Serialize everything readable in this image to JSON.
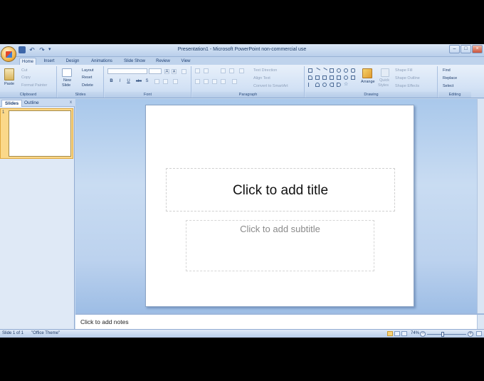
{
  "window": {
    "title": "Presentation1 - Microsoft PowerPoint non-commercial use"
  },
  "quick_access": {
    "more_glyph": "▾"
  },
  "tabs": [
    {
      "label": "Home",
      "active": true
    },
    {
      "label": "Insert"
    },
    {
      "label": "Design"
    },
    {
      "label": "Animations"
    },
    {
      "label": "Slide Show"
    },
    {
      "label": "Review"
    },
    {
      "label": "View"
    }
  ],
  "ribbon": {
    "clipboard": {
      "paste": "Paste",
      "cut": "Cut",
      "copy": "Copy",
      "format_painter": "Format Painter",
      "label": "Clipboard"
    },
    "slides": {
      "new_slide": "New",
      "new_slide2": "Slide",
      "layout": "Layout",
      "reset": "Reset",
      "delete": "Delete",
      "label": "Slides"
    },
    "font": {
      "bold": "B",
      "italic": "I",
      "underline": "U",
      "strike": "abc",
      "shadow": "S",
      "grow": "A",
      "shrink": "A",
      "label": "Font"
    },
    "paragraph": {
      "text_direction": "Text Direction",
      "align_text": "Align Text",
      "smartart": "Convert to SmartArt",
      "label": "Paragraph"
    },
    "drawing": {
      "arrange": "Arrange",
      "quick_styles": "Quick",
      "quick_styles2": "Styles",
      "shape_fill": "Shape Fill",
      "shape_outline": "Shape Outline",
      "shape_effects": "Shape Effects",
      "label": "Drawing"
    },
    "editing": {
      "find": "Find",
      "replace": "Replace",
      "select": "Select",
      "label": "Editing"
    }
  },
  "left_pane": {
    "tab_slides": "Slides",
    "tab_outline": "Outline",
    "close": "x",
    "slide_number": "1"
  },
  "slide": {
    "title_placeholder": "Click to add title",
    "subtitle_placeholder": "Click to add subtitle"
  },
  "notes": {
    "placeholder": "Click to add notes"
  },
  "status": {
    "slide_of": "Slide 1 of 1",
    "theme": "\"Office Theme\"",
    "zoom": "74%"
  },
  "colors": {
    "accent": "#c6d8ee",
    "selection": "#fbd889"
  }
}
